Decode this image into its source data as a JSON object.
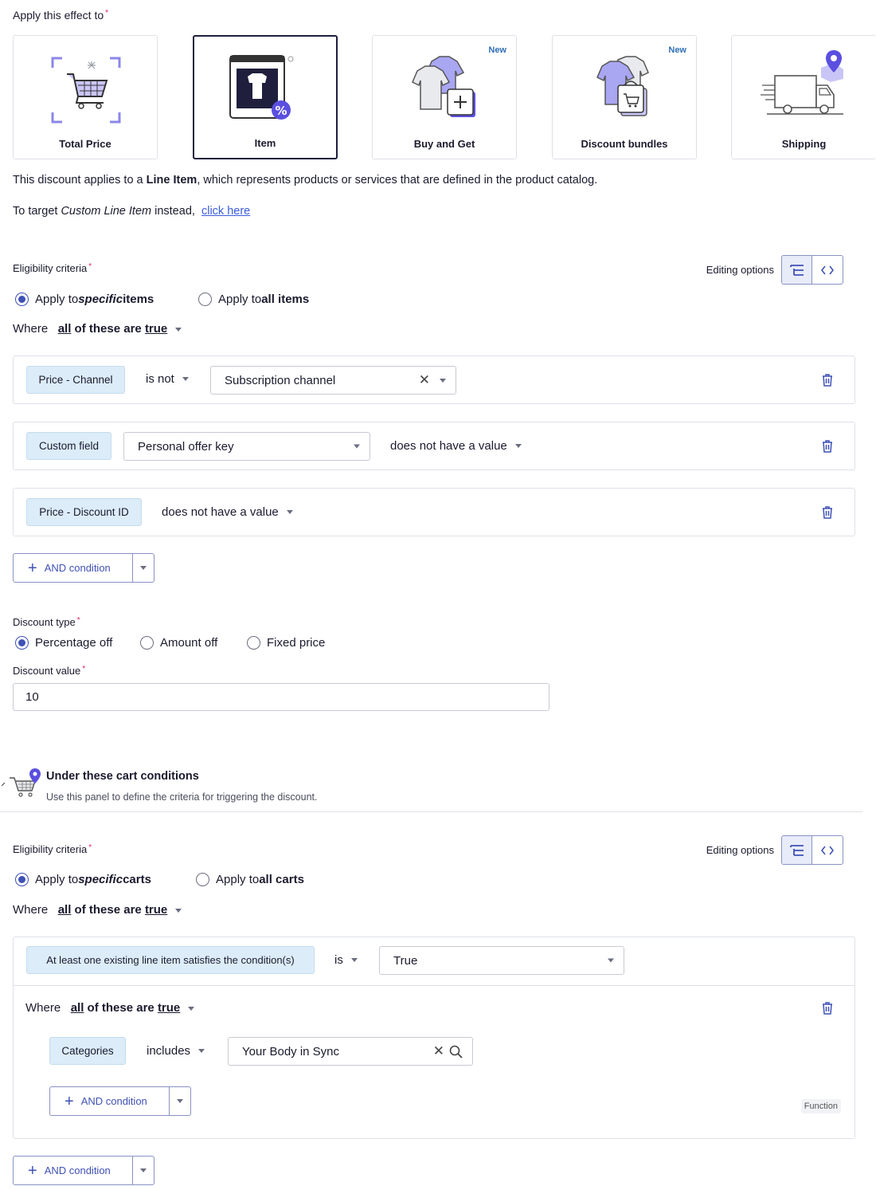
{
  "apply_effect": {
    "label": "Apply this effect to",
    "cards": [
      {
        "label": "Total Price",
        "selected": false,
        "badge": ""
      },
      {
        "label": "Item",
        "selected": true,
        "badge": ""
      },
      {
        "label": "Buy and Get",
        "selected": false,
        "badge": "New"
      },
      {
        "label": "Discount bundles",
        "selected": false,
        "badge": "New"
      },
      {
        "label": "Shipping",
        "selected": false,
        "badge": ""
      }
    ]
  },
  "info": {
    "p1_pre": "This discount applies to a ",
    "p1_bold": "Line Item",
    "p1_post": ", which represents products or services that are defined in the product catalog.",
    "p2_pre": "To target ",
    "p2_italic": "Custom Line Item",
    "p2_post": " instead,",
    "p2_link": "click here"
  },
  "item_section": {
    "eligibility_label": "Eligibility criteria",
    "editing_options": "Editing options",
    "radio_specific_pre": "Apply to ",
    "radio_specific_em": "specific",
    "radio_specific_post": " items",
    "radio_all_pre": "Apply to ",
    "radio_all_bold": "all items",
    "where": "Where",
    "where_all": "all",
    "where_mid": " of these are ",
    "where_true": "true",
    "conditions": [
      {
        "chip": "Price - Channel",
        "operator": "is not",
        "value": "Subscription channel"
      },
      {
        "chip": "Custom field",
        "field": "Personal offer key",
        "operator": "does not have a value"
      },
      {
        "chip": "Price - Discount ID",
        "operator": "does not have a value"
      }
    ],
    "and_button": "AND condition"
  },
  "discount": {
    "type_label": "Discount type",
    "types": [
      "Percentage off",
      "Amount off",
      "Fixed price"
    ],
    "selected_type": "Percentage off",
    "value_label": "Discount value",
    "value": "10"
  },
  "cart_panel": {
    "title": "Under these cart conditions",
    "subtitle": "Use this panel to define the criteria for triggering the discount."
  },
  "cart_section": {
    "eligibility_label": "Eligibility criteria",
    "editing_options": "Editing options",
    "radio_specific_pre": "Apply to ",
    "radio_specific_em": "specific",
    "radio_specific_post": " carts",
    "radio_all_pre": "Apply to ",
    "radio_all_bold": "all carts",
    "where": "Where",
    "where_all": "all",
    "where_mid": " of these are ",
    "where_true": "true",
    "condition": {
      "chip": "At least one existing line item satisfies the condition(s)",
      "operator": "is",
      "value": "True"
    },
    "nested": {
      "where": "Where",
      "where_all": "all",
      "where_mid": " of these are ",
      "where_true": "true",
      "chip": "Categories",
      "operator": "includes",
      "value": "Your Body in Sync",
      "and_button": "AND condition",
      "function_tag": "Function"
    },
    "and_button": "AND condition"
  },
  "colors": {
    "accent": "#3f51b5",
    "chip_bg": "#dcecf8",
    "badge": "#2f6fb3",
    "illustration_purple": "#a9a6f2"
  }
}
